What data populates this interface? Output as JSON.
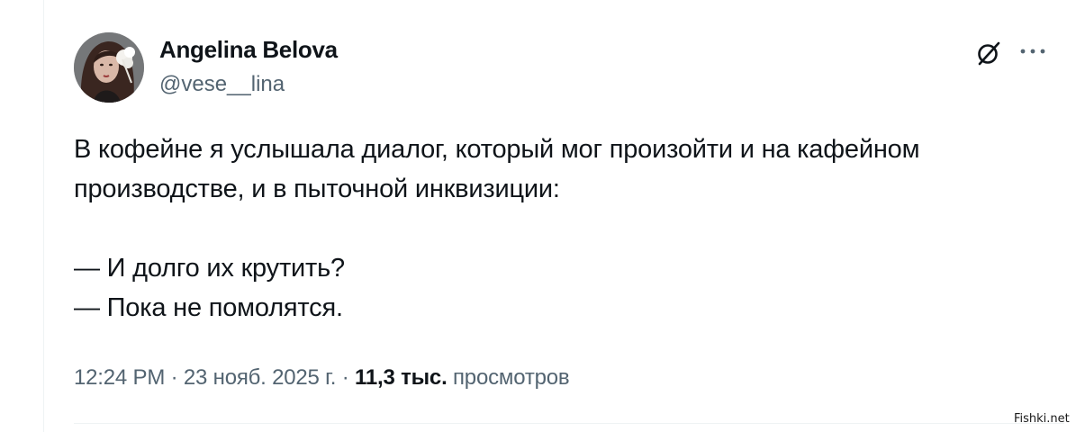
{
  "author": {
    "name": "Angelina Belova",
    "handle": "@vese__lina"
  },
  "header_icons": [
    "grok-icon",
    "more-icon"
  ],
  "tweet": {
    "lines": [
      "В кофейне я услышала диалог, который мог произойти и на кафейном",
      "производстве, и в пыточной инквизиции:",
      "— И долго их крутить?",
      "— Пока не помолятся."
    ]
  },
  "meta": {
    "time": "12:24 PM",
    "separator": "·",
    "date": "23 нояб. 2025 г.",
    "views_count": "11,3 тыс.",
    "views_label": "просмотров"
  },
  "watermark": "Fishki.net",
  "colors": {
    "text": "#0f1419",
    "secondary": "#536471",
    "divider": "#eff3f4"
  }
}
